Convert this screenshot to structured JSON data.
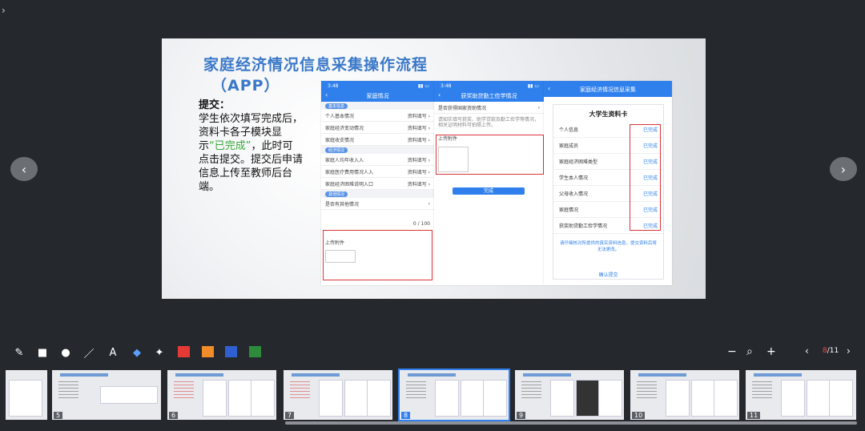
{
  "nav": {
    "prev_icon": "‹",
    "next_icon": "›",
    "top_icon": "›"
  },
  "slide": {
    "title": "家庭经济情况信息采集操作流程",
    "title_app": "（APP）",
    "heading": "提交：",
    "body_1": "学生依次填写完成后，资料卡各子模块显示",
    "body_highlight": "“已完成”",
    "body_2": "，此时可点击提交。提交后申请信息上传至教师后台端。",
    "phone1": {
      "time": "3:48",
      "title": "家庭情况",
      "rows": [
        {
          "label": "个人基本情况",
          "status": "资料填写 ›"
        },
        {
          "label": "家庭经济变动情况",
          "status": "资料填写 ›"
        },
        {
          "label": "家庭收支情况",
          "status": "资料填写 ›"
        },
        {
          "label": "家庭人均年收入入",
          "status": "资料填写 ›"
        },
        {
          "label": "家庭医疗费用情况人入",
          "status": "资料填写 ›"
        },
        {
          "label": "家庭经济困难说明入口",
          "status": "资料填写 ›"
        }
      ],
      "upload_label": "上传附件",
      "count": "0 / 100"
    },
    "phone2": {
      "time": "3:48",
      "title": "获奖助贷勤工俭学情况",
      "upload_label": "上传附件",
      "button": "完成"
    },
    "card": {
      "header": "家庭经济情况信息采集",
      "title": "大学生资料卡",
      "rows": [
        {
          "label": "个人信息",
          "status": "已完成"
        },
        {
          "label": "家庭成员",
          "status": "已完成"
        },
        {
          "label": "家庭经济困难类型",
          "status": "已完成"
        },
        {
          "label": "学生本人情况",
          "status": "已完成"
        },
        {
          "label": "父母收入情况",
          "status": "已完成"
        },
        {
          "label": "家庭情况",
          "status": "已完成"
        },
        {
          "label": "获奖助贷勤工俭学情况",
          "status": "已完成"
        }
      ],
      "note": "请仔细核对所提供的真实资料信息，提交资料后将无法更改。",
      "submit": "确认提交"
    }
  },
  "toolbar": {
    "colors": [
      "#e53935",
      "#f28c28",
      "#2f5fd0",
      "#2e8b3a"
    ],
    "page_current": "8",
    "page_total": "/11"
  },
  "thumbnails": [
    {
      "num": ""
    },
    {
      "num": "5"
    },
    {
      "num": "6"
    },
    {
      "num": "7"
    },
    {
      "num": "8"
    },
    {
      "num": "9"
    },
    {
      "num": "10"
    },
    {
      "num": "11"
    }
  ]
}
